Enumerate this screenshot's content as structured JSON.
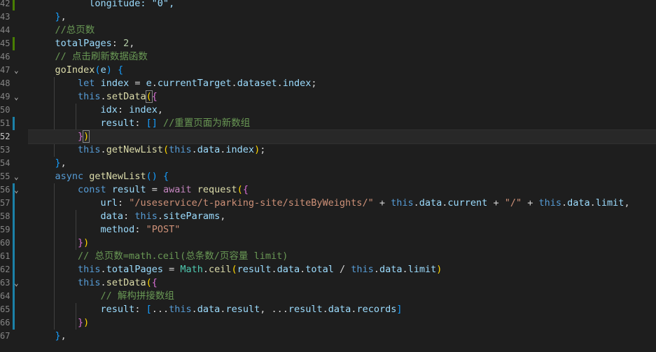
{
  "editor": {
    "colors": {
      "background": "#1e1e1e",
      "current_line": "#282828",
      "line_number": "#858585",
      "modified_bar": "#1b81a8",
      "added_bar": "#487e02"
    },
    "current_line_number": "52",
    "lines": [
      {
        "num": "42",
        "fold": "",
        "mod": "add",
        "tokens": [
          {
            "t": "          longitude: \"0\",",
            "c": "t-prop"
          }
        ]
      },
      {
        "num": "43",
        "fold": "",
        "mod": "",
        "tokens": [
          {
            "t": "    ",
            "c": "t-punc"
          },
          {
            "t": "}",
            "c": "t-b3"
          },
          {
            "t": ",",
            "c": "t-punc"
          }
        ]
      },
      {
        "num": "44",
        "fold": "",
        "mod": "",
        "tokens": [
          {
            "t": "    //总页数",
            "c": "t-cmt"
          }
        ]
      },
      {
        "num": "45",
        "fold": "",
        "mod": "add",
        "tokens": [
          {
            "t": "    ",
            "c": "t-punc"
          },
          {
            "t": "totalPages",
            "c": "t-prop"
          },
          {
            "t": ": ",
            "c": "t-punc"
          },
          {
            "t": "2",
            "c": "t-num"
          },
          {
            "t": ",",
            "c": "t-punc"
          }
        ]
      },
      {
        "num": "46",
        "fold": "",
        "mod": "",
        "tokens": [
          {
            "t": "    // 点击刷新数据函数",
            "c": "t-cmt"
          }
        ]
      },
      {
        "num": "47",
        "fold": "⌄",
        "mod": "",
        "tokens": [
          {
            "t": "    ",
            "c": "t-punc"
          },
          {
            "t": "goIndex",
            "c": "t-fn"
          },
          {
            "t": "(",
            "c": "t-b3"
          },
          {
            "t": "e",
            "c": "t-prop"
          },
          {
            "t": ") ",
            "c": "t-b3"
          },
          {
            "t": "{",
            "c": "t-b3"
          }
        ]
      },
      {
        "num": "48",
        "fold": "",
        "mod": "",
        "tokens": [
          {
            "t": "        ",
            "c": "t-punc"
          },
          {
            "t": "let",
            "c": "t-kw"
          },
          {
            "t": " ",
            "c": "t-punc"
          },
          {
            "t": "index",
            "c": "t-prop"
          },
          {
            "t": " = ",
            "c": "t-punc"
          },
          {
            "t": "e",
            "c": "t-prop"
          },
          {
            "t": ".",
            "c": "t-punc"
          },
          {
            "t": "currentTarget",
            "c": "t-prop"
          },
          {
            "t": ".",
            "c": "t-punc"
          },
          {
            "t": "dataset",
            "c": "t-prop"
          },
          {
            "t": ".",
            "c": "t-punc"
          },
          {
            "t": "index",
            "c": "t-prop"
          },
          {
            "t": ";",
            "c": "t-punc"
          }
        ]
      },
      {
        "num": "49",
        "fold": "⌄",
        "mod": "",
        "tokens": [
          {
            "t": "        ",
            "c": "t-punc"
          },
          {
            "t": "this",
            "c": "t-kw"
          },
          {
            "t": ".",
            "c": "t-punc"
          },
          {
            "t": "setData",
            "c": "t-fn"
          },
          {
            "t": "(",
            "c": "t-b1 t-match"
          },
          {
            "t": "{",
            "c": "t-b2"
          }
        ]
      },
      {
        "num": "50",
        "fold": "",
        "mod": "",
        "tokens": [
          {
            "t": "            ",
            "c": "t-punc"
          },
          {
            "t": "idx",
            "c": "t-prop"
          },
          {
            "t": ": ",
            "c": "t-punc"
          },
          {
            "t": "index",
            "c": "t-prop"
          },
          {
            "t": ",",
            "c": "t-punc"
          }
        ]
      },
      {
        "num": "51",
        "fold": "",
        "mod": "mod",
        "tokens": [
          {
            "t": "            ",
            "c": "t-punc"
          },
          {
            "t": "result",
            "c": "t-prop"
          },
          {
            "t": ": ",
            "c": "t-punc"
          },
          {
            "t": "[]",
            "c": "t-b3"
          },
          {
            "t": " //重置页面为新数组",
            "c": "t-cmt"
          }
        ]
      },
      {
        "num": "52",
        "fold": "",
        "mod": "",
        "tokens": [
          {
            "t": "        ",
            "c": "t-punc"
          },
          {
            "t": "}",
            "c": "t-b2"
          },
          {
            "t": ")",
            "c": "t-b1 t-match"
          }
        ]
      },
      {
        "num": "53",
        "fold": "",
        "mod": "",
        "tokens": [
          {
            "t": "        ",
            "c": "t-punc"
          },
          {
            "t": "this",
            "c": "t-kw"
          },
          {
            "t": ".",
            "c": "t-punc"
          },
          {
            "t": "getNewList",
            "c": "t-fn"
          },
          {
            "t": "(",
            "c": "t-b1"
          },
          {
            "t": "this",
            "c": "t-kw"
          },
          {
            "t": ".",
            "c": "t-punc"
          },
          {
            "t": "data",
            "c": "t-prop"
          },
          {
            "t": ".",
            "c": "t-punc"
          },
          {
            "t": "index",
            "c": "t-prop"
          },
          {
            "t": ")",
            "c": "t-b1"
          },
          {
            "t": ";",
            "c": "t-punc"
          }
        ]
      },
      {
        "num": "54",
        "fold": "",
        "mod": "",
        "tokens": [
          {
            "t": "    ",
            "c": "t-punc"
          },
          {
            "t": "}",
            "c": "t-b3"
          },
          {
            "t": ",",
            "c": "t-punc"
          }
        ]
      },
      {
        "num": "55",
        "fold": "⌄",
        "mod": "",
        "tokens": [
          {
            "t": "    ",
            "c": "t-punc"
          },
          {
            "t": "async",
            "c": "t-kw"
          },
          {
            "t": " ",
            "c": "t-punc"
          },
          {
            "t": "getNewList",
            "c": "t-fn"
          },
          {
            "t": "() ",
            "c": "t-b3"
          },
          {
            "t": "{",
            "c": "t-b3"
          }
        ]
      },
      {
        "num": "56",
        "fold": "⌄",
        "mod": "mod",
        "tokens": [
          {
            "t": "        ",
            "c": "t-punc"
          },
          {
            "t": "const",
            "c": "t-kw"
          },
          {
            "t": " ",
            "c": "t-punc"
          },
          {
            "t": "result",
            "c": "t-prop"
          },
          {
            "t": " = ",
            "c": "t-punc"
          },
          {
            "t": "await",
            "c": "t-kw2"
          },
          {
            "t": " ",
            "c": "t-punc"
          },
          {
            "t": "request",
            "c": "t-fn"
          },
          {
            "t": "(",
            "c": "t-b1"
          },
          {
            "t": "{",
            "c": "t-b2"
          }
        ]
      },
      {
        "num": "57",
        "fold": "",
        "mod": "mod",
        "tokens": [
          {
            "t": "            ",
            "c": "t-punc"
          },
          {
            "t": "url",
            "c": "t-prop"
          },
          {
            "t": ": ",
            "c": "t-punc"
          },
          {
            "t": "\"/useservice/t-parking-site/siteByWeights/\"",
            "c": "t-str"
          },
          {
            "t": " + ",
            "c": "t-punc"
          },
          {
            "t": "this",
            "c": "t-kw"
          },
          {
            "t": ".",
            "c": "t-punc"
          },
          {
            "t": "data",
            "c": "t-prop"
          },
          {
            "t": ".",
            "c": "t-punc"
          },
          {
            "t": "current",
            "c": "t-prop"
          },
          {
            "t": " + ",
            "c": "t-punc"
          },
          {
            "t": "\"/\"",
            "c": "t-str"
          },
          {
            "t": " + ",
            "c": "t-punc"
          },
          {
            "t": "this",
            "c": "t-kw"
          },
          {
            "t": ".",
            "c": "t-punc"
          },
          {
            "t": "data",
            "c": "t-prop"
          },
          {
            "t": ".",
            "c": "t-punc"
          },
          {
            "t": "limit",
            "c": "t-prop"
          },
          {
            "t": ",",
            "c": "t-punc"
          }
        ]
      },
      {
        "num": "58",
        "fold": "",
        "mod": "mod",
        "tokens": [
          {
            "t": "            ",
            "c": "t-punc"
          },
          {
            "t": "data",
            "c": "t-prop"
          },
          {
            "t": ": ",
            "c": "t-punc"
          },
          {
            "t": "this",
            "c": "t-kw"
          },
          {
            "t": ".",
            "c": "t-punc"
          },
          {
            "t": "siteParams",
            "c": "t-prop"
          },
          {
            "t": ",",
            "c": "t-punc"
          }
        ]
      },
      {
        "num": "59",
        "fold": "",
        "mod": "mod",
        "tokens": [
          {
            "t": "            ",
            "c": "t-punc"
          },
          {
            "t": "method",
            "c": "t-prop"
          },
          {
            "t": ": ",
            "c": "t-punc"
          },
          {
            "t": "\"POST\"",
            "c": "t-str"
          }
        ]
      },
      {
        "num": "60",
        "fold": "",
        "mod": "mod",
        "tokens": [
          {
            "t": "        ",
            "c": "t-punc"
          },
          {
            "t": "}",
            "c": "t-b2"
          },
          {
            "t": ")",
            "c": "t-b1"
          }
        ]
      },
      {
        "num": "61",
        "fold": "",
        "mod": "mod",
        "tokens": [
          {
            "t": "        // 总页数=math.ceil(总条数/页容量 limit)",
            "c": "t-cmt"
          }
        ]
      },
      {
        "num": "62",
        "fold": "",
        "mod": "mod",
        "tokens": [
          {
            "t": "        ",
            "c": "t-punc"
          },
          {
            "t": "this",
            "c": "t-kw"
          },
          {
            "t": ".",
            "c": "t-punc"
          },
          {
            "t": "totalPages",
            "c": "t-prop"
          },
          {
            "t": " = ",
            "c": "t-punc"
          },
          {
            "t": "Math",
            "c": "t-cls"
          },
          {
            "t": ".",
            "c": "t-punc"
          },
          {
            "t": "ceil",
            "c": "t-fn"
          },
          {
            "t": "(",
            "c": "t-b1"
          },
          {
            "t": "result",
            "c": "t-prop"
          },
          {
            "t": ".",
            "c": "t-punc"
          },
          {
            "t": "data",
            "c": "t-prop"
          },
          {
            "t": ".",
            "c": "t-punc"
          },
          {
            "t": "total",
            "c": "t-prop"
          },
          {
            "t": " / ",
            "c": "t-punc"
          },
          {
            "t": "this",
            "c": "t-kw"
          },
          {
            "t": ".",
            "c": "t-punc"
          },
          {
            "t": "data",
            "c": "t-prop"
          },
          {
            "t": ".",
            "c": "t-punc"
          },
          {
            "t": "limit",
            "c": "t-prop"
          },
          {
            "t": ")",
            "c": "t-b1"
          }
        ]
      },
      {
        "num": "63",
        "fold": "⌄",
        "mod": "mod",
        "tokens": [
          {
            "t": "        ",
            "c": "t-punc"
          },
          {
            "t": "this",
            "c": "t-kw"
          },
          {
            "t": ".",
            "c": "t-punc"
          },
          {
            "t": "setData",
            "c": "t-fn"
          },
          {
            "t": "(",
            "c": "t-b1"
          },
          {
            "t": "{",
            "c": "t-b2"
          }
        ]
      },
      {
        "num": "64",
        "fold": "",
        "mod": "mod",
        "tokens": [
          {
            "t": "            // 解构拼接数组",
            "c": "t-cmt"
          }
        ]
      },
      {
        "num": "65",
        "fold": "",
        "mod": "mod",
        "tokens": [
          {
            "t": "            ",
            "c": "t-punc"
          },
          {
            "t": "result",
            "c": "t-prop"
          },
          {
            "t": ": ",
            "c": "t-punc"
          },
          {
            "t": "[",
            "c": "t-b3"
          },
          {
            "t": "...",
            "c": "t-punc"
          },
          {
            "t": "this",
            "c": "t-kw"
          },
          {
            "t": ".",
            "c": "t-punc"
          },
          {
            "t": "data",
            "c": "t-prop"
          },
          {
            "t": ".",
            "c": "t-punc"
          },
          {
            "t": "result",
            "c": "t-prop"
          },
          {
            "t": ", ...",
            "c": "t-punc"
          },
          {
            "t": "result",
            "c": "t-prop"
          },
          {
            "t": ".",
            "c": "t-punc"
          },
          {
            "t": "data",
            "c": "t-prop"
          },
          {
            "t": ".",
            "c": "t-punc"
          },
          {
            "t": "records",
            "c": "t-prop"
          },
          {
            "t": "]",
            "c": "t-b3"
          }
        ]
      },
      {
        "num": "66",
        "fold": "",
        "mod": "mod",
        "tokens": [
          {
            "t": "        ",
            "c": "t-punc"
          },
          {
            "t": "}",
            "c": "t-b2"
          },
          {
            "t": ")",
            "c": "t-b1"
          }
        ]
      },
      {
        "num": "67",
        "fold": "",
        "mod": "",
        "tokens": [
          {
            "t": "    ",
            "c": "t-punc"
          },
          {
            "t": "}",
            "c": "t-b3"
          },
          {
            "t": ",",
            "c": "t-punc"
          }
        ]
      }
    ]
  }
}
